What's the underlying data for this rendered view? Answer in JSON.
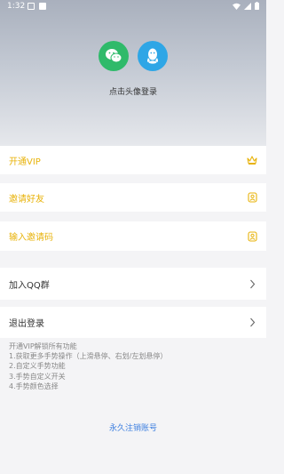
{
  "status_bar": {
    "time": "1:32"
  },
  "header": {
    "login_hint": "点击头像登录"
  },
  "menu": {
    "vip": "开通VIP",
    "invite_friends": "邀请好友",
    "enter_invite_code": "输入邀请码",
    "join_qq_group": "加入QQ群",
    "logout": "退出登录"
  },
  "vip_info": {
    "title": "开通VIP解锁所有功能",
    "lines": [
      "1.获取更多手势操作（上滑悬停、右划/左划悬停）",
      "2.自定义手势功能",
      "3.手势自定义开关",
      "4.手势颜色选择"
    ]
  },
  "footer": {
    "cancel_account": "永久注销账号"
  },
  "colors": {
    "gold": "#e8b30b",
    "link": "#3d7fe0",
    "wechat": "#2fba6a",
    "qq": "#2ea6e6"
  },
  "icons": [
    "wechat-icon",
    "qq-icon",
    "crown-icon",
    "badge-icon",
    "chevron-right-icon",
    "wifi-icon",
    "signal-icon",
    "battery-icon"
  ]
}
